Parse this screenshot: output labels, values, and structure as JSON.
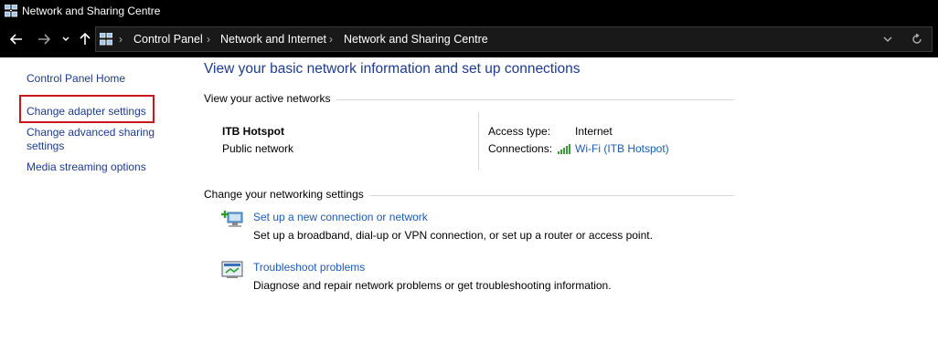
{
  "window": {
    "title": "Network and Sharing Centre"
  },
  "breadcrumb": [
    "Control Panel",
    "Network and Internet",
    "Network and Sharing Centre"
  ],
  "sidebar": {
    "items": [
      {
        "label": "Control Panel Home"
      },
      {
        "label": "Change adapter settings"
      },
      {
        "label_line1": "Change advanced sharing",
        "label_line2": "settings"
      },
      {
        "label": "Media streaming options"
      }
    ]
  },
  "main": {
    "title": "View your basic network information and set up connections",
    "active_networks_label": "View your active networks",
    "network": {
      "name": "ITB Hotspot",
      "type": "Public network",
      "access_type_label": "Access type:",
      "access_type_value": "Internet",
      "connections_label": "Connections:",
      "connection_value": "Wi-Fi (ITB Hotspot)"
    },
    "settings_label": "Change your networking settings",
    "tasks": [
      {
        "title": "Set up a new connection or network",
        "description": "Set up a broadband, dial-up or VPN connection, or set up a router or access point.",
        "icon": "network-setup-icon"
      },
      {
        "title": "Troubleshoot problems",
        "description": "Diagnose and repair network problems or get troubleshooting information.",
        "icon": "troubleshoot-icon"
      }
    ]
  },
  "colors": {
    "link": "#1a5bb5",
    "title": "#1c3b8f",
    "highlight": "#c8161d",
    "chrome": "#000000"
  }
}
